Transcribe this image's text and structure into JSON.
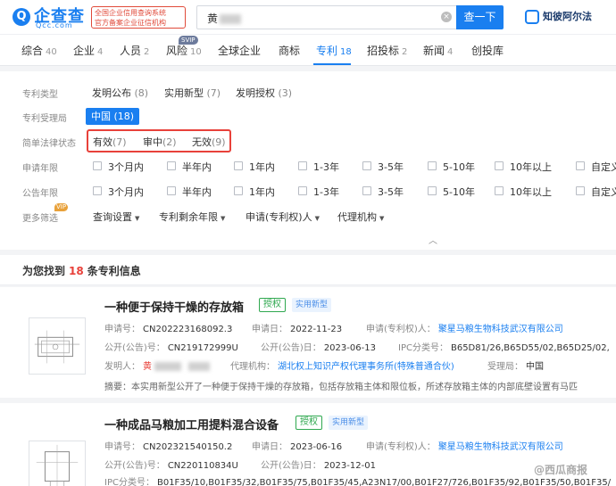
{
  "header": {
    "logo_char": "Q",
    "logo_text": "企查查",
    "logo_sub": "Qcc.com",
    "cert_line1": "全国企业信用查询系统",
    "cert_line2": "官方备案企业征信机构",
    "search_value": "黄",
    "search_button": "查一下",
    "zhiche_label": "知彼阿尔法"
  },
  "tabs": [
    {
      "label": "综合",
      "count": "40"
    },
    {
      "label": "企业",
      "count": "4"
    },
    {
      "label": "人员",
      "count": "2"
    },
    {
      "label": "风险",
      "count": "10"
    },
    {
      "label": "全球企业",
      "count": ""
    },
    {
      "label": "商标",
      "count": ""
    },
    {
      "label": "专利",
      "count": "18"
    },
    {
      "label": "招投标",
      "count": "2"
    },
    {
      "label": "新闻",
      "count": "4"
    },
    {
      "label": "创投库",
      "count": ""
    }
  ],
  "svip_badge": "SVIP",
  "filters": {
    "patent_type_label": "专利类型",
    "patent_types": [
      {
        "label": "发明公布",
        "count": "(8)"
      },
      {
        "label": "实用新型",
        "count": "(7)"
      },
      {
        "label": "发明授权",
        "count": "(3)"
      }
    ],
    "office_label": "专利受理局",
    "office_chip": "中国 (18)",
    "status_label": "简单法律状态",
    "statuses": [
      {
        "label": "有效",
        "count": "(7)"
      },
      {
        "label": "审中",
        "count": "(2)"
      },
      {
        "label": "无效",
        "count": "(9)"
      }
    ],
    "apply_year_label": "申请年限",
    "pub_year_label": "公告年限",
    "year_options": [
      "3个月内",
      "半年内",
      "1年内",
      "1-3年",
      "3-5年",
      "5-10年",
      "10年以上",
      "自定义"
    ],
    "more_label": "更多筛选",
    "vip_badge": "VIP",
    "dropdowns": [
      "查询设置",
      "专利剩余年限",
      "申请(专利权)人",
      "代理机构"
    ]
  },
  "results": {
    "prefix": "为您找到",
    "count": "18",
    "suffix": "条专利信息"
  },
  "patents": [
    {
      "title": "一种便于保持干燥的存放箱",
      "status_tag": "授权",
      "type_tag": "实用新型",
      "app_no_label": "申请号：",
      "app_no": "CN202223168092.3",
      "app_date_label": "申请日：",
      "app_date": "2022-11-23",
      "applicant_label": "申请(专利权)人：",
      "applicant": "聚星马粮生物科技武汉有限公司",
      "pub_no_label": "公开(公告)号：",
      "pub_no": "CN219172999U",
      "pub_date_label": "公开(公告)日：",
      "pub_date": "2023-06-13",
      "ipc_label": "IPC分类号：",
      "ipc": "B65D81/26,B65D55/02,B65D25/02,",
      "inventor_label": "发明人：",
      "inventor": "黄",
      "agency_label": "代理机构：",
      "agency": "湖北权上知识产权代理事务所(特殊普通合伙)",
      "office_label": "受理局：",
      "office": "中国",
      "abstract": "摘要：本实用新型公开了一种便于保持干燥的存放箱，包括存放箱主体和限位板，所述存放箱主体的内部底壁设置有马匹"
    },
    {
      "title": "一种成品马粮加工用提料混合设备",
      "status_tag": "授权",
      "type_tag": "实用新型",
      "app_no_label": "申请号：",
      "app_no": "CN202321540150.2",
      "app_date_label": "申请日：",
      "app_date": "2023-06-16",
      "applicant_label": "申请(专利权)人：",
      "applicant": "聚星马粮生物科技武汉有限公司",
      "pub_no_label": "公开(公告)号：",
      "pub_no": "CN220110834U",
      "pub_date_label": "公开(公告)日：",
      "pub_date": "2023-12-01",
      "ipc_label": "IPC分类号：",
      "ipc": "B01F35/10,B01F35/32,B01F35/75,B01F35/45,A23N17/00,B01F27/726,B01F35/92,B01F35/50,B01F35/"
    }
  ],
  "watermark": "@西瓜商报"
}
